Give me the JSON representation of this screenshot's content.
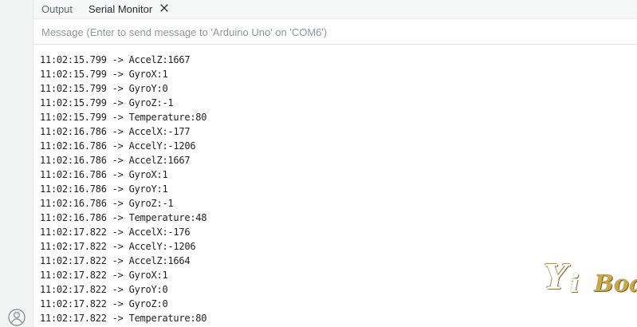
{
  "tabs": [
    {
      "label": "Output"
    },
    {
      "label": "Serial Monitor"
    }
  ],
  "message": {
    "placeholder": "Message (Enter to send message to 'Arduino Uno' on 'COM6')",
    "value": ""
  },
  "serial_lines": [
    "11:02:15.799 -> AccelZ:1667",
    "11:02:15.799 -> GyroX:1",
    "11:02:15.799 -> GyroY:0",
    "11:02:15.799 -> GyroZ:-1",
    "11:02:15.799 -> Temperature:80",
    "11:02:16.786 -> AccelX:-177",
    "11:02:16.786 -> AccelY:-1206",
    "11:02:16.786 -> AccelZ:1667",
    "11:02:16.786 -> GyroX:1",
    "11:02:16.786 -> GyroY:1",
    "11:02:16.786 -> GyroZ:-1",
    "11:02:16.786 -> Temperature:48",
    "11:02:17.822 -> AccelX:-176",
    "11:02:17.822 -> AccelY:-1206",
    "11:02:17.822 -> AccelZ:1664",
    "11:02:17.822 -> GyroX:1",
    "11:02:17.822 -> GyroY:0",
    "11:02:17.822 -> GyroZ:0",
    "11:02:17.822 -> Temperature:80"
  ],
  "watermark": "YiBoard",
  "icons": {
    "close": "close-icon",
    "account": "account-icon"
  },
  "colors": {
    "tab_active_text": "#1f2a30",
    "tab_inactive_text": "#5c6a70",
    "placeholder_text": "#8e979b",
    "logo_gold": "#c8a84b"
  }
}
